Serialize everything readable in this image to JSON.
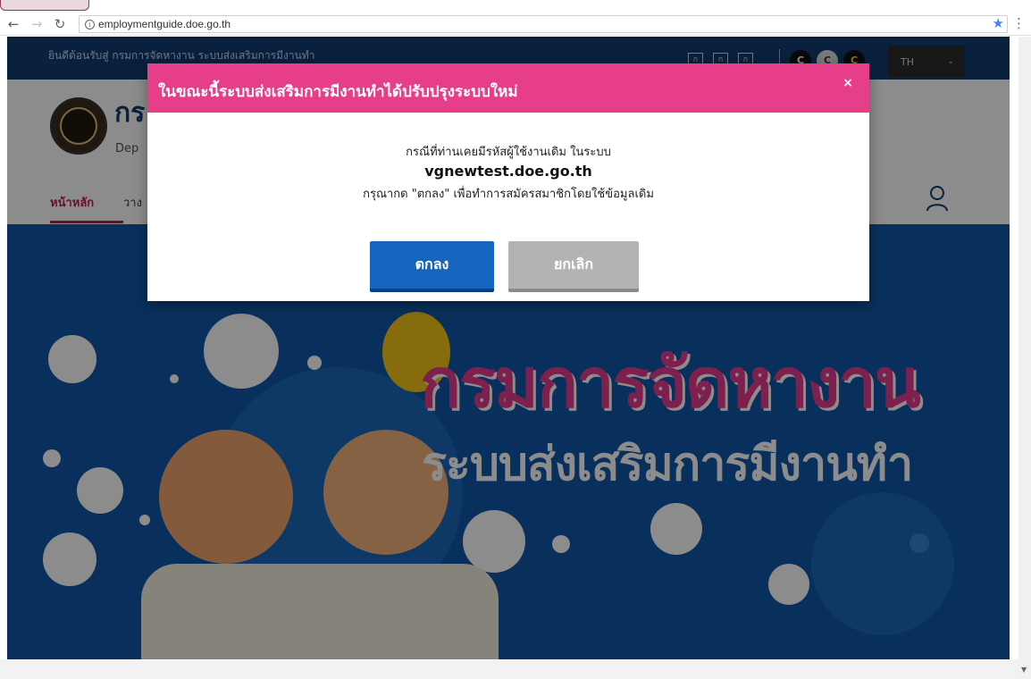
{
  "browser": {
    "url": "employmentguide.doe.go.th"
  },
  "site": {
    "welcome": "ยินดีต้อนรับสู่ กรมการจัดหางาน ระบบส่งเสริมการมีงานทำ",
    "font_size_buttons": [
      "ก",
      "ก",
      "ก"
    ],
    "contrast_buttons": [
      "C",
      "C",
      "C"
    ],
    "language": "TH",
    "brand_th": "กร",
    "brand_en": "Dep",
    "menu_home": "หน้าหลัก",
    "menu_second": "วาง"
  },
  "hero": {
    "title_line1": "กรมการจัดหางาน",
    "title_line2": "ระบบส่งเสริมการมีงานทำ"
  },
  "modal": {
    "title": "ในขณะนี้ระบบส่งเสริมการมีงานทำได้ปรับปรุงระบบใหม่",
    "close": "×",
    "line1": "กรณีที่ท่านเคยมีรหัสผู้ใช้งานเดิม ในระบบ",
    "line2": "vgnewtest.doe.go.th",
    "line3": "กรุณากด \"ตกลง\" เพื่อทำการสมัครสมาชิกโดยใช้ข้อมูลเดิม",
    "ok_label": "ตกลง",
    "cancel_label": "ยกเลิก"
  },
  "colors": {
    "modal_header": "#e63e88",
    "ok_button": "#1565c0",
    "cancel_button": "#b3b3b3",
    "topbar": "#123c73",
    "hero_bg": "#1256a8"
  }
}
